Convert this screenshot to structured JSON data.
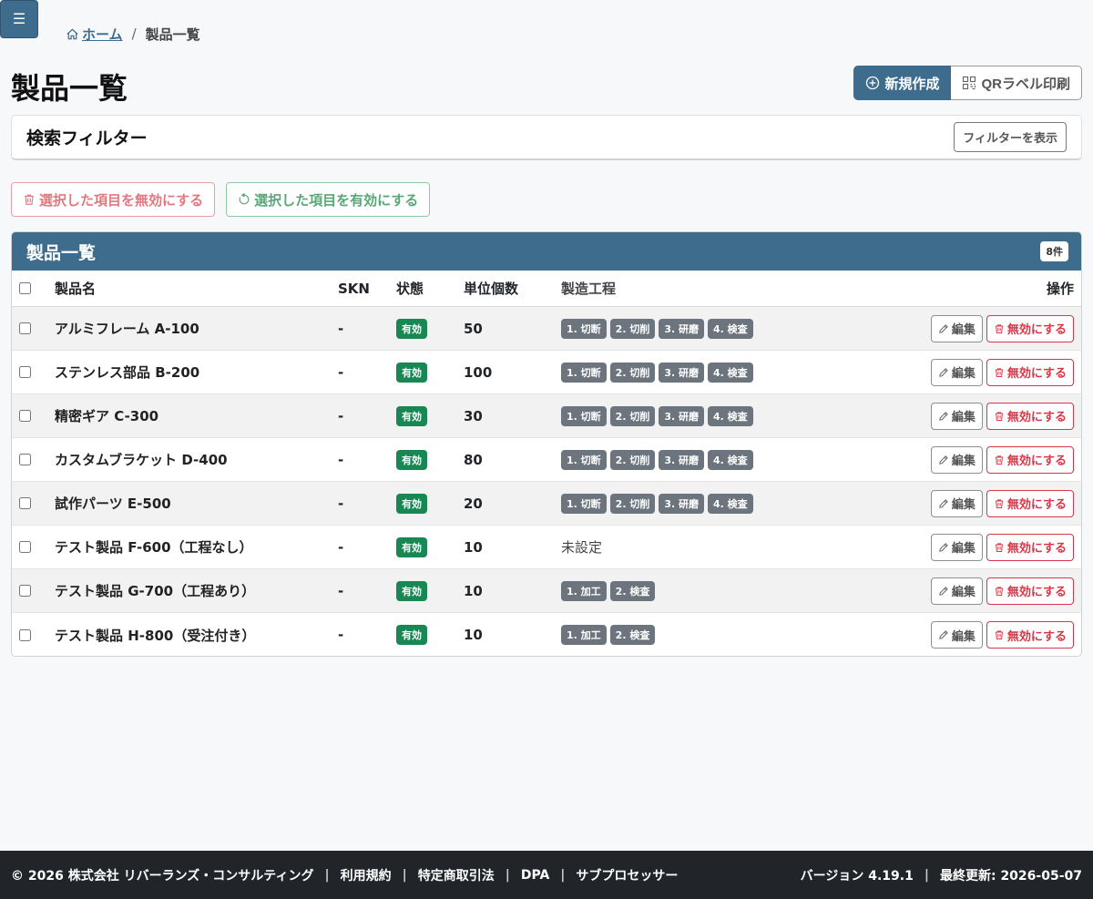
{
  "nav": {
    "menu_icon": "hamburger-icon"
  },
  "breadcrumb": {
    "home": "ホーム",
    "current": "製品一覧"
  },
  "page": {
    "title": "製品一覧"
  },
  "actions": {
    "new": "新規作成",
    "qr": "QRラベル印刷"
  },
  "filter": {
    "title": "検索フィルター",
    "toggle": "フィルターを表示"
  },
  "bulk": {
    "disable": "選択した項目を無効にする",
    "enable": "選択した項目を有効にする"
  },
  "table": {
    "title": "製品一覧",
    "count": "8件",
    "headers": {
      "name": "製品名",
      "skn": "SKN",
      "status": "状態",
      "unit": "単位個数",
      "process": "製造工程",
      "ops": "操作"
    },
    "edit_label": "編集",
    "disable_label": "無効にする",
    "rows": [
      {
        "name": "アルミフレーム A-100",
        "skn": "-",
        "status": "有効",
        "unit": "50",
        "processes": [
          "1. 切断",
          "2. 切削",
          "3. 研磨",
          "4. 検査"
        ],
        "process_text": ""
      },
      {
        "name": "ステンレス部品 B-200",
        "skn": "-",
        "status": "有効",
        "unit": "100",
        "processes": [
          "1. 切断",
          "2. 切削",
          "3. 研磨",
          "4. 検査"
        ],
        "process_text": ""
      },
      {
        "name": "精密ギア C-300",
        "skn": "-",
        "status": "有効",
        "unit": "30",
        "processes": [
          "1. 切断",
          "2. 切削",
          "3. 研磨",
          "4. 検査"
        ],
        "process_text": ""
      },
      {
        "name": "カスタムブラケット D-400",
        "skn": "-",
        "status": "有効",
        "unit": "80",
        "processes": [
          "1. 切断",
          "2. 切削",
          "3. 研磨",
          "4. 検査"
        ],
        "process_text": ""
      },
      {
        "name": "試作パーツ E-500",
        "skn": "-",
        "status": "有効",
        "unit": "20",
        "processes": [
          "1. 切断",
          "2. 切削",
          "3. 研磨",
          "4. 検査"
        ],
        "process_text": ""
      },
      {
        "name": "テスト製品 F-600（工程なし）",
        "skn": "-",
        "status": "有効",
        "unit": "10",
        "processes": [],
        "process_text": "未設定"
      },
      {
        "name": "テスト製品 G-700（工程あり）",
        "skn": "-",
        "status": "有効",
        "unit": "10",
        "processes": [
          "1. 加工",
          "2. 検査"
        ],
        "process_text": ""
      },
      {
        "name": "テスト製品 H-800（受注付き）",
        "skn": "-",
        "status": "有効",
        "unit": "10",
        "processes": [
          "1. 加工",
          "2. 検査"
        ],
        "process_text": ""
      }
    ]
  },
  "footer": {
    "links": [
      "© 2026 株式会社 リバーランズ・コンサルティング",
      "利用規約",
      "特定商取引法",
      "DPA",
      "サブプロセッサー"
    ],
    "version": "バージョン 4.19.1",
    "updated": "最終更新: 2026-05-07"
  }
}
